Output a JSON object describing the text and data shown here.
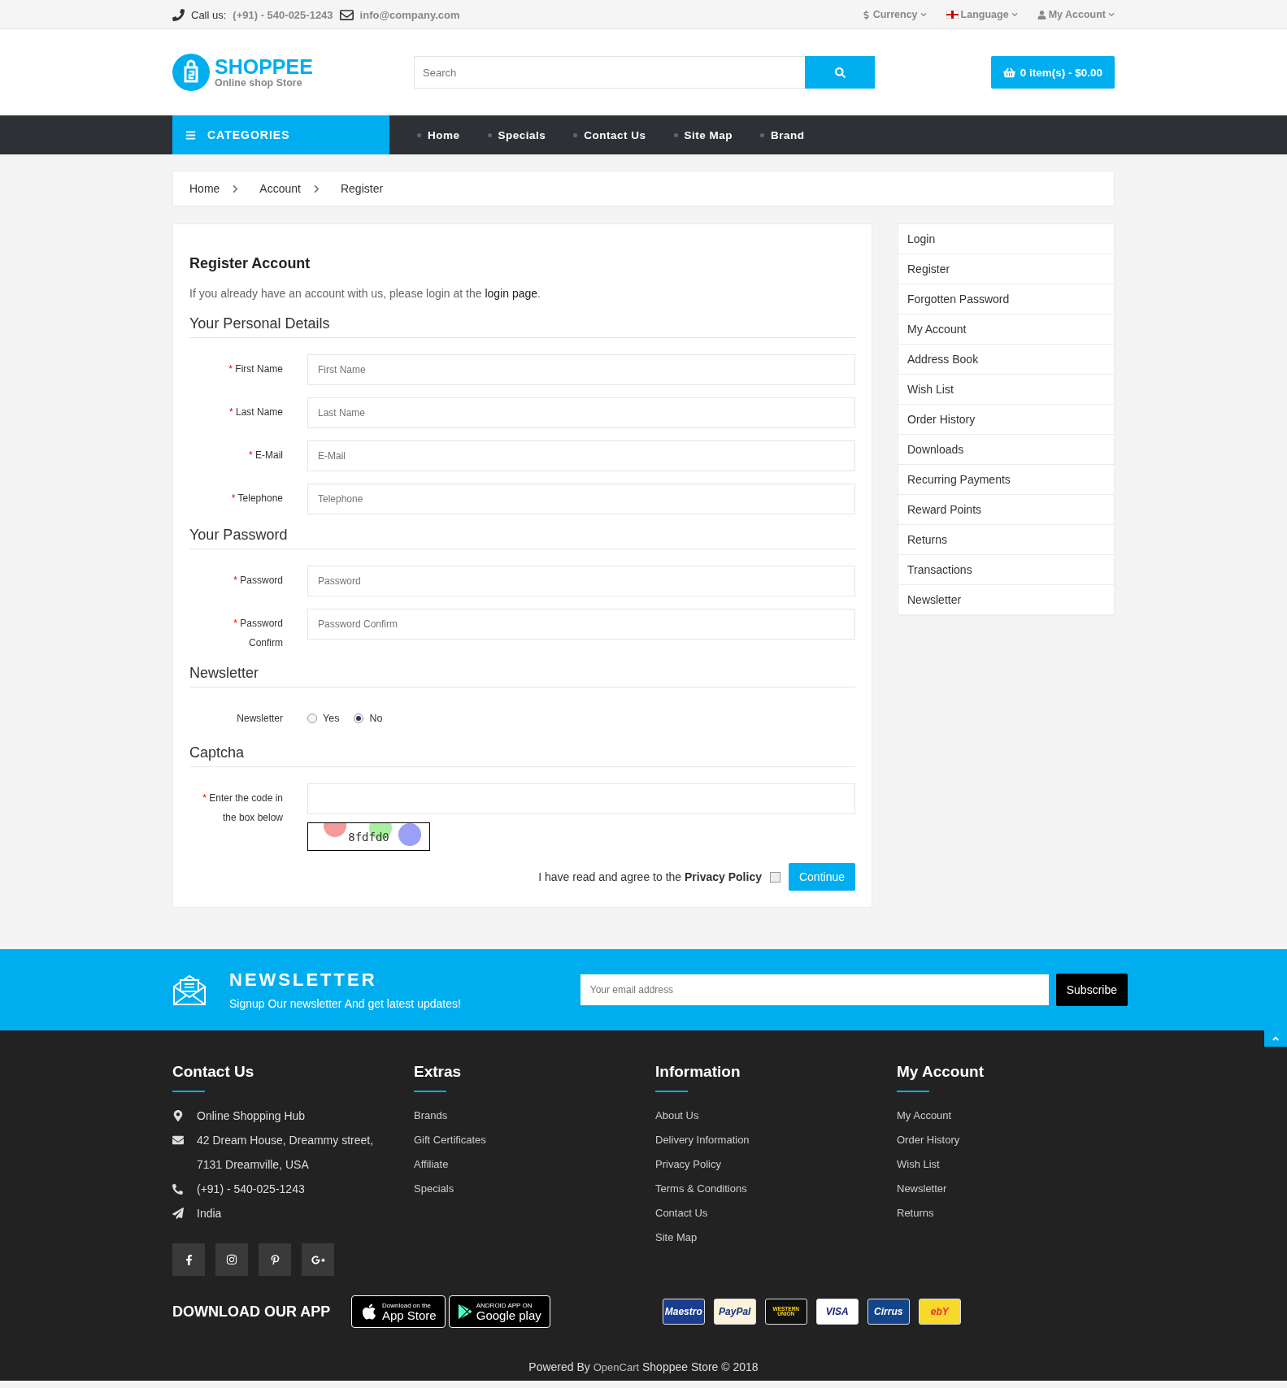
{
  "topbar": {
    "call_label": "Call us:",
    "phone": "(+91) - 540-025-1243",
    "email": "info@company.com",
    "menus": [
      {
        "kind": "currency",
        "label": "Currency"
      },
      {
        "kind": "language",
        "label": "Language"
      },
      {
        "kind": "account",
        "label": "My Account"
      }
    ]
  },
  "header": {
    "logo": {
      "title": "SHOPPEE",
      "subtitle": "Online shop Store"
    },
    "search": {
      "placeholder": "Search"
    },
    "cart": "0 item(s) - $0.00"
  },
  "nav": {
    "categories": "CATEGORIES",
    "items": [
      "Home",
      "Specials",
      "Contact Us",
      "Site Map",
      "Brand"
    ]
  },
  "breadcrumb": [
    "Home",
    "Account",
    "Register"
  ],
  "register": {
    "title": "Register Account",
    "required_mark": "*",
    "intro": {
      "before": "If you already have an account with us, please login at the ",
      "link": "login page",
      "after": "."
    },
    "sections": [
      {
        "title": "Your Personal Details",
        "fields": [
          {
            "kind": "text",
            "label": "First Name",
            "required": true,
            "placeholder": "First Name"
          },
          {
            "kind": "text",
            "label": "Last Name",
            "required": true,
            "placeholder": "Last Name"
          },
          {
            "kind": "text",
            "label": "E-Mail",
            "required": true,
            "placeholder": "E-Mail"
          },
          {
            "kind": "text",
            "label": "Telephone",
            "required": true,
            "placeholder": "Telephone"
          }
        ]
      },
      {
        "title": "Your Password",
        "fields": [
          {
            "kind": "text",
            "label": "Password",
            "required": true,
            "placeholder": "Password"
          },
          {
            "kind": "text",
            "label": "Password Confirm",
            "required": true,
            "placeholder": "Password Confirm"
          }
        ]
      },
      {
        "title": "Newsletter",
        "fields": [
          {
            "kind": "radio",
            "label": "Newsletter",
            "required": false,
            "options": [
              {
                "label": "Yes",
                "selected": false
              },
              {
                "label": "No",
                "selected": true
              }
            ]
          }
        ]
      },
      {
        "title": "Captcha",
        "fields": [
          {
            "kind": "captcha",
            "label": "Enter the code in the box below",
            "required": true,
            "code": "8fdfd0"
          }
        ]
      }
    ],
    "agree": {
      "before": "I have read and agree to the ",
      "link": "Privacy Policy",
      "checked": false
    },
    "continue": "Continue"
  },
  "sidebar": [
    "Login",
    "Register",
    "Forgotten Password",
    "My Account",
    "Address Book",
    "Wish List",
    "Order History",
    "Downloads",
    "Recurring Payments",
    "Reward Points",
    "Returns",
    "Transactions",
    "Newsletter"
  ],
  "newsletter": {
    "title": "NEWSLETTER",
    "subtitle": "Signup Our newsletter And get latest updates!",
    "placeholder": "Your email address",
    "button": "Subscribe"
  },
  "footer": {
    "contact": {
      "title": "Contact Us",
      "items": [
        {
          "kind": "pin",
          "text": "Online Shopping Hub"
        },
        {
          "kind": "envelope",
          "text": "42 Dream House, Dreammy street, 7131 Dreamville, USA"
        },
        {
          "kind": "phone",
          "text": "(+91) - 540-025-1243"
        },
        {
          "kind": "plane",
          "text": "India"
        }
      ]
    },
    "columns": [
      {
        "title": "Extras",
        "links": [
          "Brands",
          "Gift Certificates",
          "Affiliate",
          "Specials"
        ]
      },
      {
        "title": "Information",
        "links": [
          "About Us",
          "Delivery Information",
          "Privacy Policy",
          "Terms & Conditions",
          "Contact Us",
          "Site Map"
        ]
      },
      {
        "title": "My Account",
        "links": [
          "My Account",
          "Order History",
          "Wish List",
          "Newsletter",
          "Returns"
        ]
      }
    ],
    "social": [
      {
        "kind": "facebook"
      },
      {
        "kind": "instagram"
      },
      {
        "kind": "pinterest"
      },
      {
        "kind": "google-plus"
      }
    ],
    "app": {
      "title": "DOWNLOAD OUR APP",
      "badges": [
        {
          "kind": "apple",
          "small": "Download on the",
          "big": "App Store"
        },
        {
          "kind": "google",
          "small": "ANDROID APP ON",
          "big": "Google play"
        }
      ]
    },
    "payments": [
      {
        "kind": "maestro",
        "label": "Maestro"
      },
      {
        "kind": "paypal",
        "label": "PayPal"
      },
      {
        "kind": "western-union",
        "label": "WESTERN UNION"
      },
      {
        "kind": "visa",
        "label": "VISA"
      },
      {
        "kind": "cirrus",
        "label": "Cirrus"
      },
      {
        "kind": "ebay",
        "label": "ebY"
      }
    ],
    "copyright": {
      "before": "Powered By ",
      "link": "OpenCart",
      "after": " Shoppee Store © 2018"
    }
  }
}
